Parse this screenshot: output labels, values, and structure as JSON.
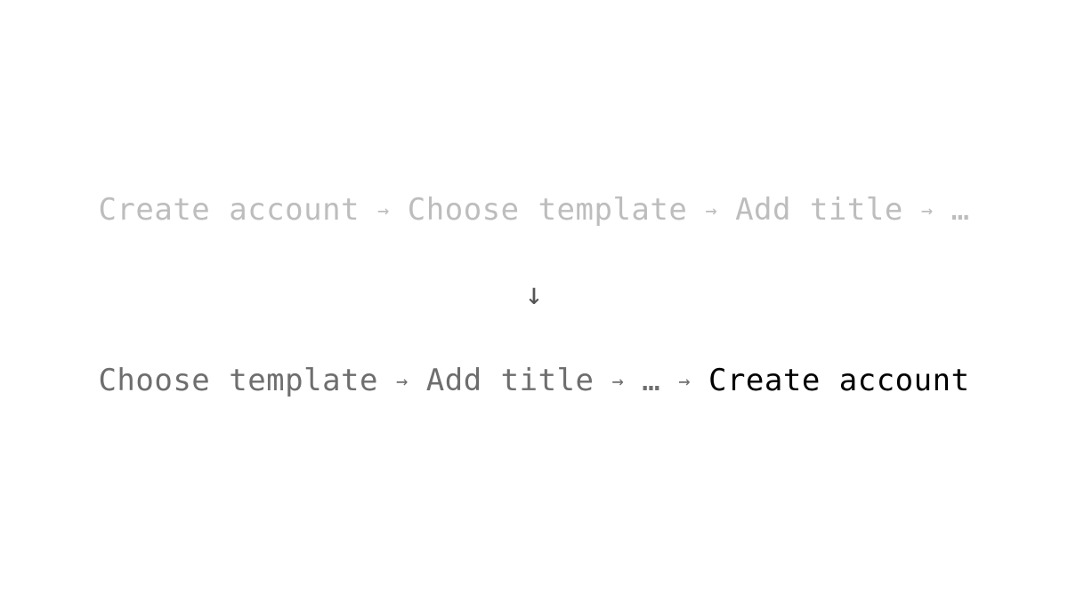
{
  "before_flow": {
    "steps": [
      "Create account",
      "Choose template",
      "Add title",
      "…"
    ],
    "separator": "→"
  },
  "transform_arrow": "↓",
  "after_flow": {
    "steps": [
      "Choose template",
      "Add title",
      "…",
      "Create account"
    ],
    "separator": "→"
  },
  "colors": {
    "before_text": "#bdbdbd",
    "after_text": "#6e6e6e",
    "highlight_text": "#000000",
    "background": "#ffffff"
  }
}
